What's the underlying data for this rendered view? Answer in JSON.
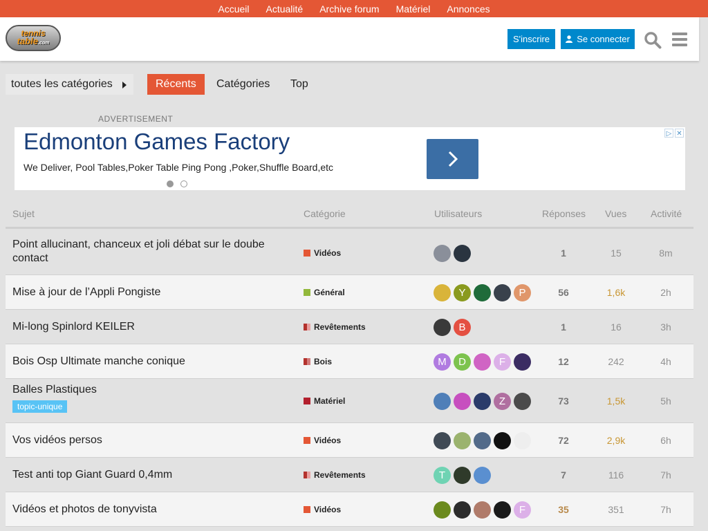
{
  "topnav": [
    "Accueil",
    "Actualité",
    "Archive forum",
    "Matériel",
    "Annonces"
  ],
  "logo": {
    "line1": "tennis",
    "line2": "table",
    "suffix": ".com"
  },
  "header": {
    "signup": "S'inscrire",
    "login": "Se connecter"
  },
  "navbar": {
    "categories_dropdown": "toutes les catégories",
    "tabs": [
      "Récents",
      "Catégories",
      "Top"
    ]
  },
  "ad": {
    "label": "ADVERTISEMENT",
    "title": "Edmonton Games Factory",
    "desc": "We Deliver, Pool Tables,Poker Table Ping Pong ,Poker,Shuffle Board,etc",
    "choice": [
      "▷",
      "✕"
    ]
  },
  "table": {
    "headers": {
      "topic": "Sujet",
      "category": "Catégorie",
      "users": "Utilisateurs",
      "replies": "Réponses",
      "views": "Vues",
      "activity": "Activité"
    },
    "rows": [
      {
        "title": "Point allucinant, chanceux et joli débat sur le doube contact",
        "category": "Vidéos",
        "cat_color": "#e45735",
        "cat_color2": "#e45735",
        "replies": "1",
        "views": "15",
        "activity": "8m",
        "hot_views": false,
        "hot_replies": false,
        "users": [
          {
            "letter": "",
            "bg": "#8a8f9a"
          },
          {
            "letter": "",
            "bg": "#2a3440"
          }
        ]
      },
      {
        "title": "Mise à jour de l’Appli Pongiste",
        "category": "Général",
        "cat_color": "#92b83b",
        "cat_color2": "#92b83b",
        "replies": "56",
        "views": "1,6k",
        "activity": "2h",
        "hot_views": true,
        "hot_replies": false,
        "users": [
          {
            "letter": "",
            "bg": "#d9b43a"
          },
          {
            "letter": "Y",
            "bg": "#8a9a1e"
          },
          {
            "letter": "",
            "bg": "#1f6b3a"
          },
          {
            "letter": "",
            "bg": "#39414c"
          },
          {
            "letter": "P",
            "bg": "#e0966a"
          }
        ]
      },
      {
        "title": "Mi-long Spinlord KEILER",
        "category": "Revêtements",
        "cat_color": "#b3322d",
        "cat_color2": "#e8a0a0",
        "replies": "1",
        "views": "16",
        "activity": "3h",
        "hot_views": false,
        "hot_replies": false,
        "users": [
          {
            "letter": "",
            "bg": "#3a3a3a"
          },
          {
            "letter": "B",
            "bg": "#e45042"
          }
        ]
      },
      {
        "title": "Bois Osp Ultimate manche conique",
        "category": "Bois",
        "cat_color": "#b3322d",
        "cat_color2": "#d27b7b",
        "replies": "12",
        "views": "242",
        "activity": "4h",
        "hot_views": false,
        "hot_replies": false,
        "users": [
          {
            "letter": "M",
            "bg": "#b07be0"
          },
          {
            "letter": "D",
            "bg": "#7dc34e"
          },
          {
            "letter": "",
            "bg": "#d064c4"
          },
          {
            "letter": "F",
            "bg": "#dcb0e8"
          },
          {
            "letter": "",
            "bg": "#3b2c63"
          }
        ]
      },
      {
        "title": "Balles Plastiques",
        "tag": "topic-unique",
        "category": "Matériel",
        "cat_color": "#b3202e",
        "cat_color2": "#b3202e",
        "replies": "73",
        "views": "1,5k",
        "activity": "5h",
        "hot_views": true,
        "hot_replies": false,
        "users": [
          {
            "letter": "",
            "bg": "#4f7fb8"
          },
          {
            "letter": "",
            "bg": "#c74fbf"
          },
          {
            "letter": "",
            "bg": "#2a3b6a"
          },
          {
            "letter": "Z",
            "bg": "#b06fa0"
          },
          {
            "letter": "",
            "bg": "#4b4b4b"
          }
        ]
      },
      {
        "title": "Vos vidéos persos",
        "category": "Vidéos",
        "cat_color": "#e45735",
        "cat_color2": "#e45735",
        "replies": "72",
        "views": "2,9k",
        "activity": "6h",
        "hot_views": true,
        "hot_replies": false,
        "users": [
          {
            "letter": "",
            "bg": "#404a55"
          },
          {
            "letter": "",
            "bg": "#9bb36e"
          },
          {
            "letter": "",
            "bg": "#536b8a"
          },
          {
            "letter": "",
            "bg": "#111111"
          },
          {
            "letter": "",
            "bg": "#eeeeee"
          }
        ]
      },
      {
        "title": "Test anti top Giant Guard 0,4mm",
        "category": "Revêtements",
        "cat_color": "#b3322d",
        "cat_color2": "#e8a0a0",
        "replies": "7",
        "views": "116",
        "activity": "7h",
        "hot_views": false,
        "hot_replies": false,
        "users": [
          {
            "letter": "T",
            "bg": "#6fd3b3"
          },
          {
            "letter": "",
            "bg": "#2f3a2a"
          },
          {
            "letter": "",
            "bg": "#5a8fd0"
          }
        ]
      },
      {
        "title": "Vidéos et photos de tonyvista",
        "category": "Vidéos",
        "cat_color": "#e45735",
        "cat_color2": "#e45735",
        "replies": "35",
        "views": "351",
        "activity": "7h",
        "hot_views": false,
        "hot_replies": true,
        "users": [
          {
            "letter": "",
            "bg": "#6b8a1e"
          },
          {
            "letter": "",
            "bg": "#2c2c2c"
          },
          {
            "letter": "",
            "bg": "#b07b6a"
          },
          {
            "letter": "",
            "bg": "#1a1a1a"
          },
          {
            "letter": "F",
            "bg": "#dcb0e8"
          }
        ]
      }
    ]
  }
}
